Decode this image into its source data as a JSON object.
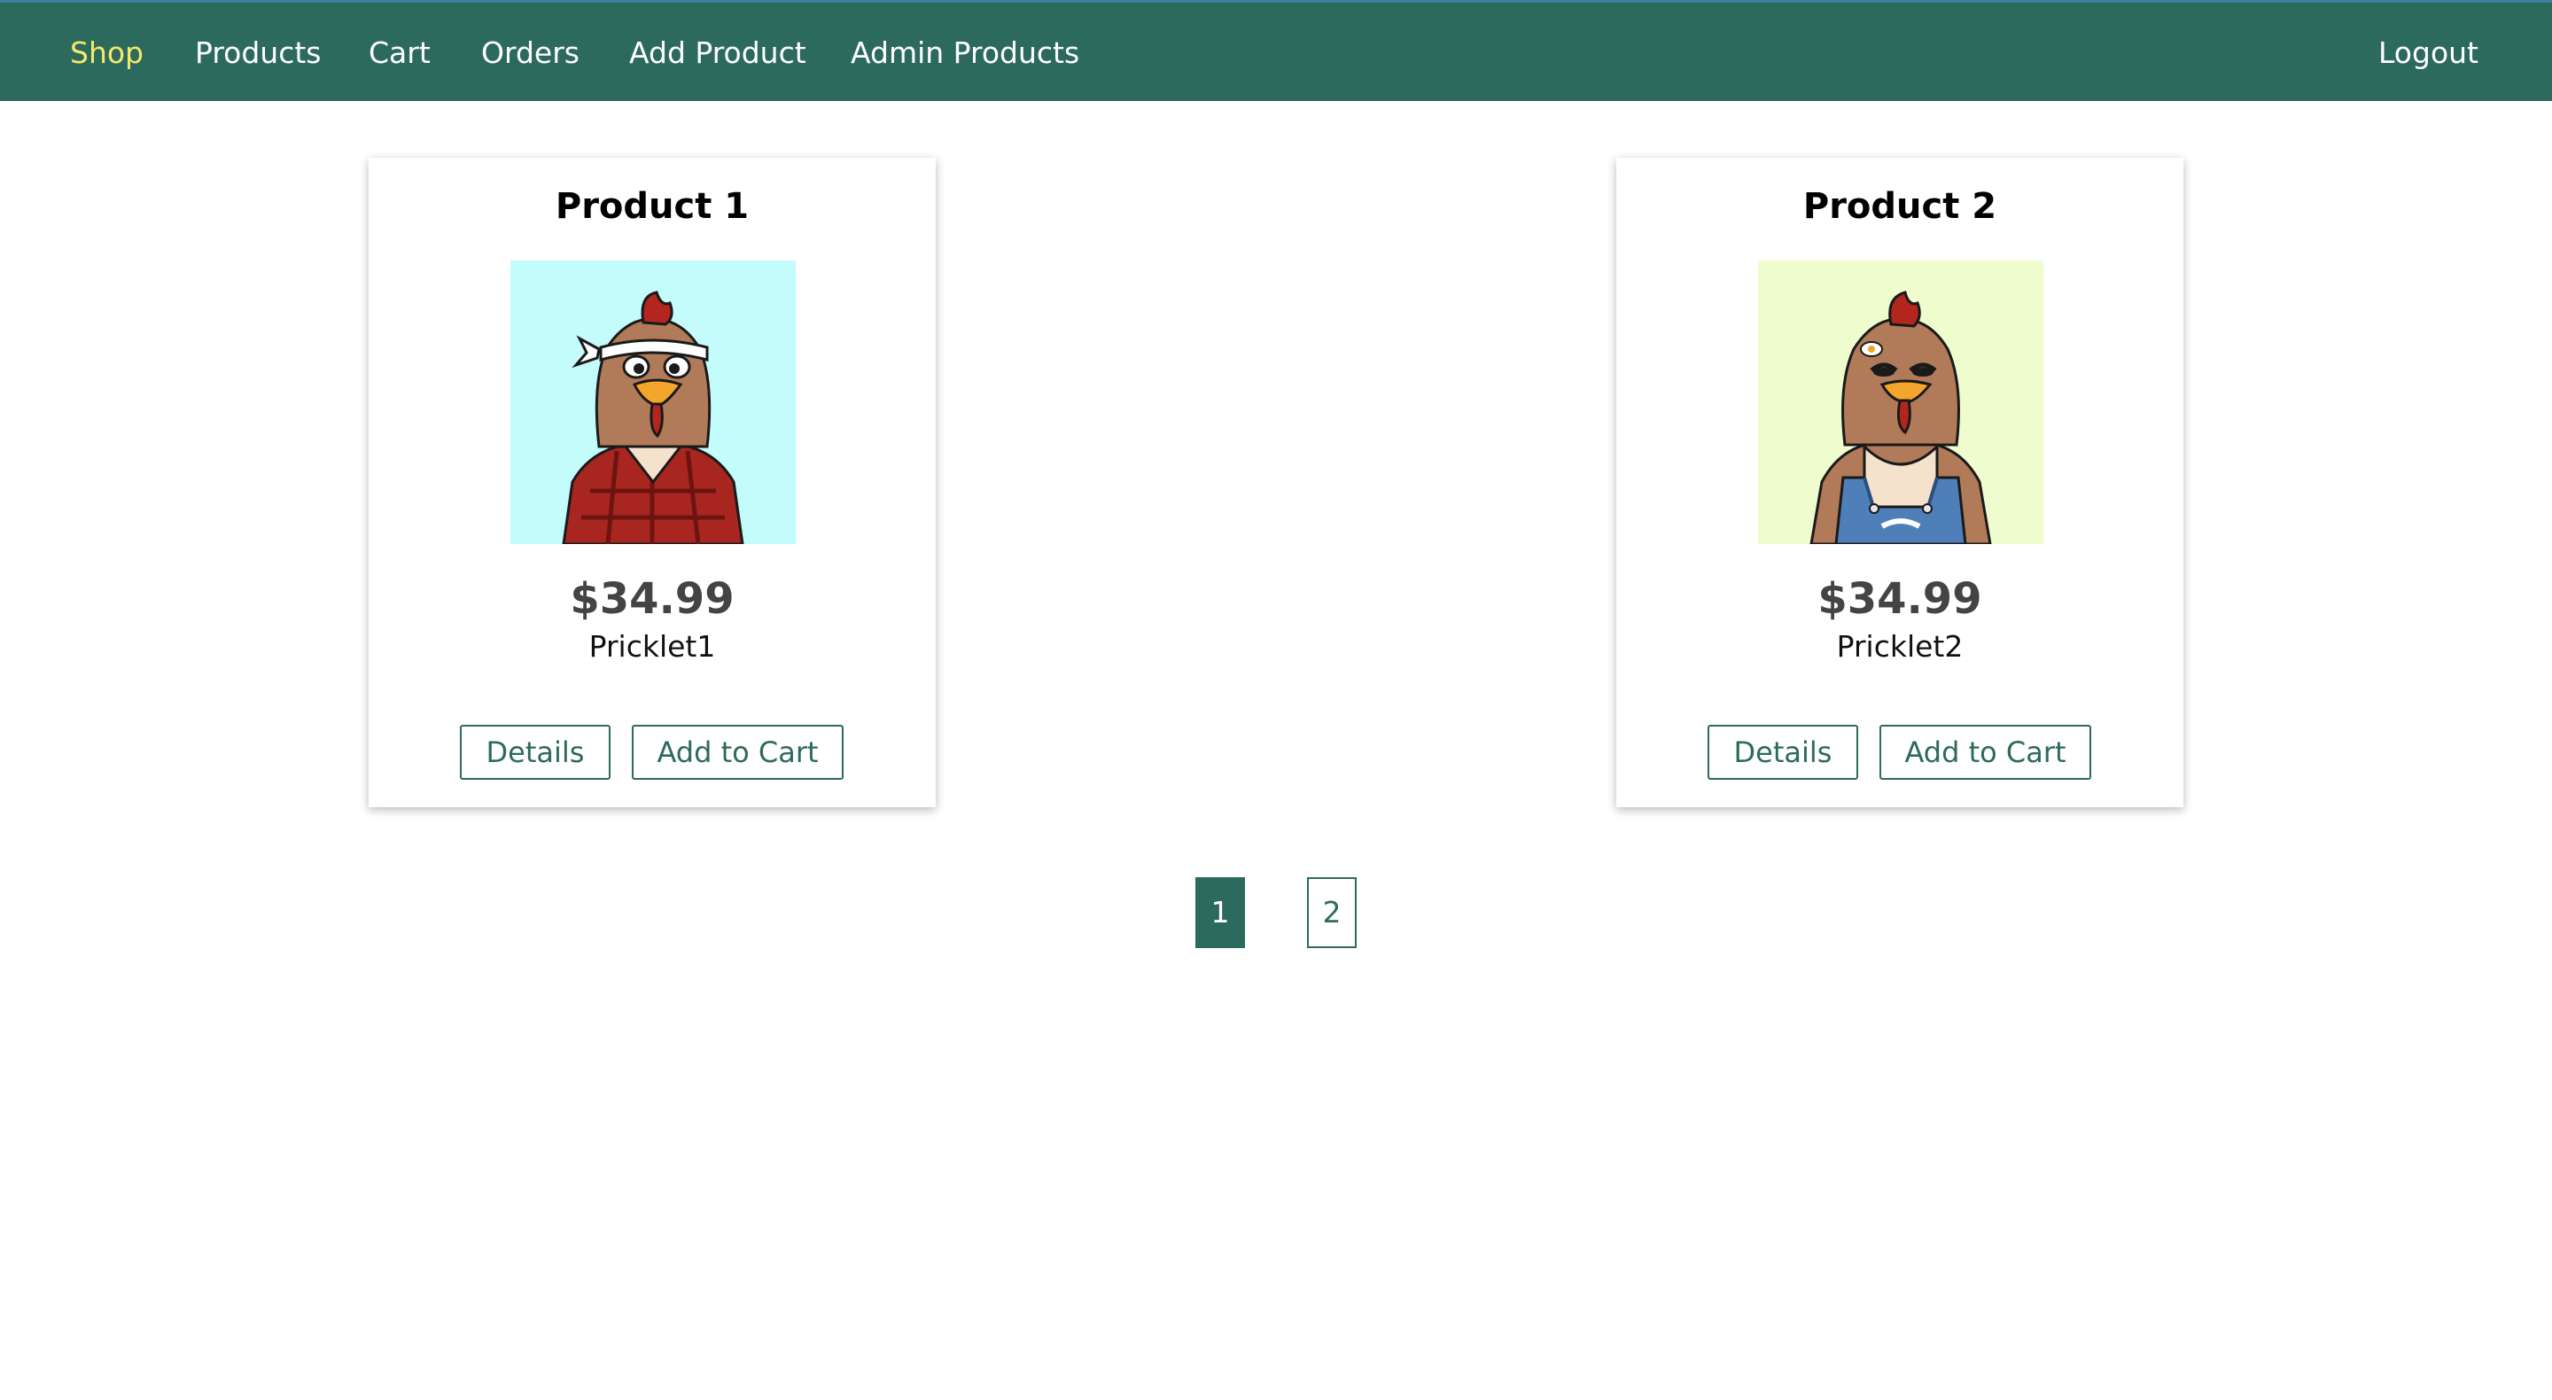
{
  "nav": {
    "items": [
      {
        "label": "Shop",
        "active": true
      },
      {
        "label": "Products",
        "active": false
      },
      {
        "label": "Cart",
        "active": false
      },
      {
        "label": "Orders",
        "active": false
      },
      {
        "label": "Add Product",
        "active": false
      },
      {
        "label": "Admin Products",
        "active": false
      }
    ],
    "logout_label": "Logout"
  },
  "products": [
    {
      "title": "Product 1",
      "price": "$34.99",
      "description": "Pricklet1",
      "image_icon": "chicken-lumberjack-illustration",
      "image_bg": "#c4fbfb",
      "details_label": "Details",
      "cart_label": "Add to Cart"
    },
    {
      "title": "Product 2",
      "price": "$34.99",
      "description": "Pricklet2",
      "image_icon": "chicken-farmer-illustration",
      "image_bg": "#eefcce",
      "details_label": "Details",
      "cart_label": "Add to Cart"
    }
  ],
  "pagination": {
    "pages": [
      "1",
      "2"
    ],
    "current": "1"
  },
  "colors": {
    "brand": "#2d6a5e",
    "active_nav": "#f4e96b"
  }
}
